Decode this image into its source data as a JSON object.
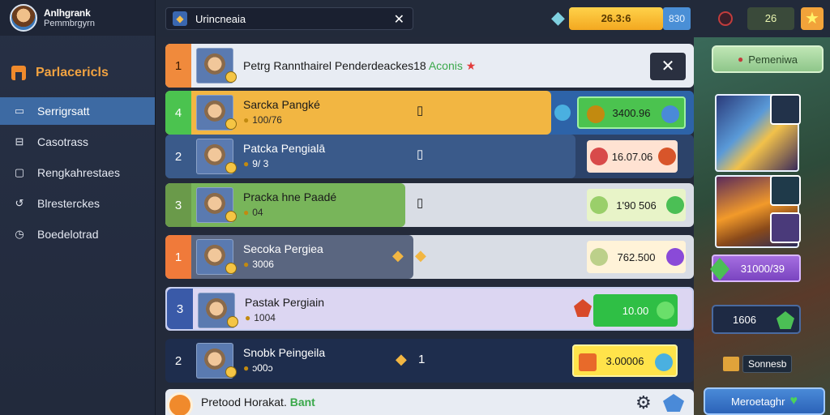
{
  "app": {
    "name": "Anlhgrank",
    "subtitle": "Pemmbrgyrn"
  },
  "sidebar": {
    "header": "Parlacericls",
    "items": [
      {
        "label": "Serrigrsatt",
        "icon": "card-icon",
        "active": true
      },
      {
        "label": "Casotrass",
        "icon": "inbox-icon",
        "active": false
      },
      {
        "label": "Rengkahrestaes",
        "icon": "window-icon",
        "active": false
      },
      {
        "label": "Blresterckes",
        "icon": "refresh-icon",
        "active": false
      },
      {
        "label": "Boedelotrad",
        "icon": "clock-icon",
        "active": false
      }
    ]
  },
  "topbar": {
    "tab_label": "Urincneaia",
    "gold": "26.3:6",
    "level": "830",
    "energy": "26"
  },
  "header_row": {
    "rank": "1",
    "title": "Petrg Rannthairel Penderdeackes18",
    "highlight": "Aconis"
  },
  "rows": [
    {
      "rank": "4",
      "name": "Sarcka Pangké",
      "sub": "100/76",
      "mid": "▯",
      "prize": "3400.96"
    },
    {
      "rank": "2",
      "name": "Patcka Pengialā",
      "sub": "9/ 3",
      "mid": "▯",
      "prize": "16.07.06"
    },
    {
      "rank": "3",
      "name": "Pracka hne Paadé",
      "sub": "04",
      "mid": "▯",
      "prize": "1'90 506"
    },
    {
      "rank": "1",
      "name": "Secoka Pergiea",
      "sub": "3006",
      "mid": "",
      "prize": "762.500"
    },
    {
      "rank": "3",
      "name": "Pastak Pergiain",
      "sub": "1004",
      "mid": "",
      "prize": "10.00"
    },
    {
      "rank": "2",
      "name": "Snobk Peingeila",
      "sub": "ɔ00ɔ",
      "mid": "1",
      "prize": "3.00006"
    }
  ],
  "footer": {
    "text": "Pretood Horakat.",
    "highlight": "Bant"
  },
  "right": {
    "top_button": "Pemeniwa",
    "purple_value": "31000/39",
    "timer": "1606",
    "chest_label": "Sonnesb",
    "bottom_button": "Meroetaghr"
  },
  "colors": {
    "accent": "#f2a341",
    "gold": "#f3a820",
    "green": "#4bc34f",
    "blue": "#3d6aa3",
    "purple": "#a56ee0"
  }
}
